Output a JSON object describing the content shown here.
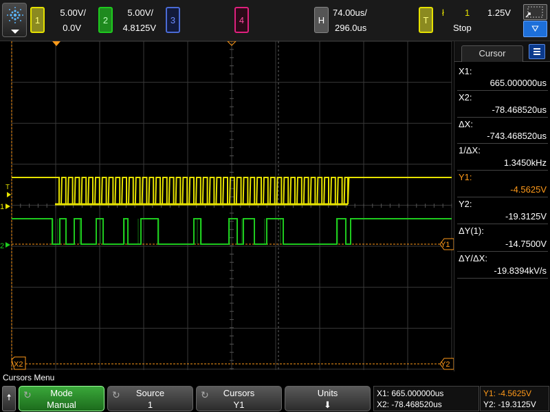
{
  "top": {
    "ch1": {
      "label": "1",
      "scale": "5.00V/",
      "offset": "0.0V"
    },
    "ch2": {
      "label": "2",
      "scale": "5.00V/",
      "offset": "4.8125V"
    },
    "ch3": {
      "label": "3"
    },
    "ch4": {
      "label": "4"
    },
    "horizontal": {
      "label": "H",
      "scale": "74.00us/",
      "delay": "296.0us"
    },
    "trigger": {
      "label": "T",
      "slope_icon": "falling-edge-icon",
      "slope_glyph": "ł",
      "source": "1",
      "level": "1.25V",
      "state": "Stop"
    }
  },
  "panel": {
    "title": "Cursor",
    "rows": [
      {
        "label": "X1:",
        "value": "665.000000us"
      },
      {
        "label": "X2:",
        "value": "-78.468520us"
      },
      {
        "label": "ΔX:",
        "value": "-743.468520us"
      },
      {
        "label": "1/ΔX:",
        "value": "1.3450kHz"
      },
      {
        "label": "Y1:",
        "value": "-4.5625V"
      },
      {
        "label": "Y2:",
        "value": "-19.3125V"
      },
      {
        "label": "ΔY(1):",
        "value": "-14.7500V"
      },
      {
        "label": "ΔY/ΔX:",
        "value": "-19.8394kV/s"
      }
    ]
  },
  "markers": {
    "t": "T",
    "ch1": "1",
    "ch2": "2",
    "y1": "Y1",
    "y2": "Y2",
    "x2": "X2"
  },
  "menu": {
    "title": "Cursors Menu",
    "up_glyph": "🠅",
    "softkeys": [
      {
        "top": "Mode",
        "bottom": "Manual"
      },
      {
        "top": "Source",
        "bottom": "1"
      },
      {
        "top": "Cursors",
        "bottom": "Y1"
      },
      {
        "top": "Units",
        "bottom": "⬇"
      }
    ],
    "readout_x": [
      "X1:  665.000000us",
      "X2: -78.468520us"
    ],
    "readout_y": [
      "Y1: -4.5625V",
      "Y2: -19.3125V"
    ]
  },
  "touch_label": "⛛",
  "colors": {
    "ch1": "#e6e200",
    "ch2": "#1ecb1e",
    "cursor": "#ff9a1a",
    "grid": "#3a3a3a"
  }
}
